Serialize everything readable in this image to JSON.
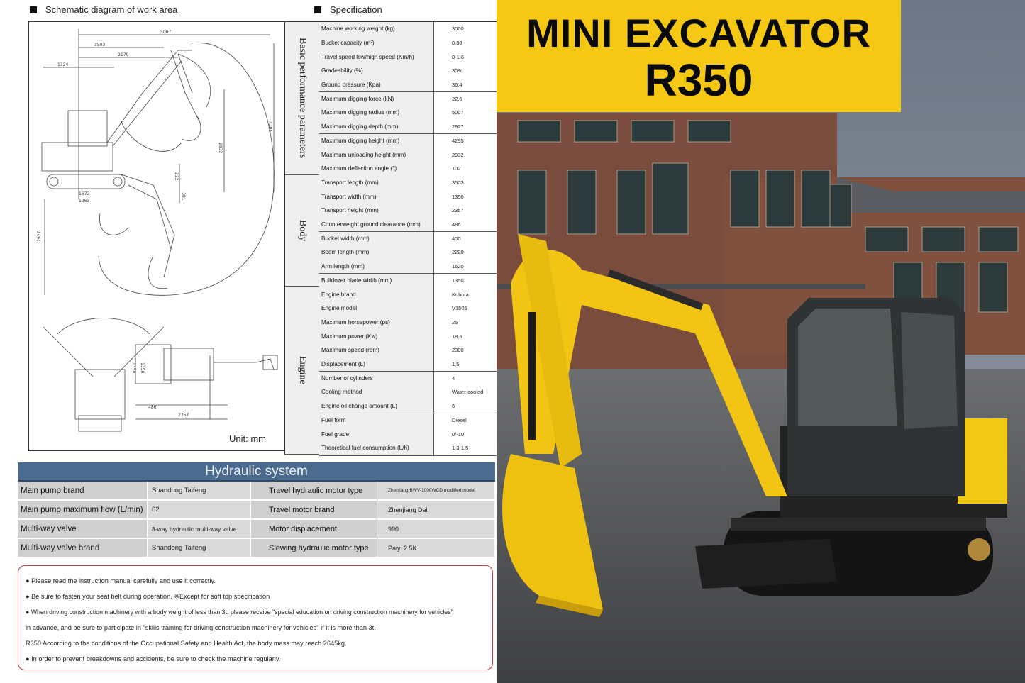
{
  "headers": {
    "schematic": "Schematic diagram of work area",
    "specification": "Specification"
  },
  "diagram": {
    "unit": "Unit: mm",
    "dims": [
      "5007",
      "3503",
      "2179",
      "1324",
      "4295",
      "2932",
      "222",
      "381",
      "1572",
      "1963",
      "2927",
      "1350",
      "2357",
      "486",
      "1350"
    ]
  },
  "spec_groups": [
    {
      "name": "Basic performance parameters",
      "rows": [
        {
          "label": "Machine working weight (kg)",
          "value": "3000"
        },
        {
          "label": "Bucket capacity (m³)",
          "value": "0.08"
        },
        {
          "label": "Travel speed low/high speed (Km/h)",
          "value": "0-1.6"
        },
        {
          "label": "Gradeability (%)",
          "value": "30%"
        },
        {
          "label": "Ground pressure (Kpa)",
          "value": "36.4"
        },
        {
          "label": "Maximum digging force (kN)",
          "value": "22.5"
        },
        {
          "label": "Maximum digging radius (mm)",
          "value": "5007"
        },
        {
          "label": "Maximum digging depth (mm)",
          "value": "2927"
        },
        {
          "label": "Maximum digging height (mm)",
          "value": "4295"
        },
        {
          "label": "Maximum unloading height (mm)",
          "value": "2932"
        },
        {
          "label": "Maximum deflection angle (°)",
          "value": "102"
        }
      ]
    },
    {
      "name": "Body",
      "rows": [
        {
          "label": "Transport length (mm)",
          "value": "3503"
        },
        {
          "label": "Transport width (mm)",
          "value": "1350"
        },
        {
          "label": "Transport height (mm)",
          "value": "2357"
        },
        {
          "label": "Counterweight ground clearance (mm)",
          "value": "486"
        },
        {
          "label": "Bucket width (mm)",
          "value": "400"
        },
        {
          "label": "Boom length (mm)",
          "value": "2220"
        },
        {
          "label": "Arm length (mm)",
          "value": "1620"
        },
        {
          "label": "Bulldozer blade width (mm)",
          "value": "1350"
        }
      ]
    },
    {
      "name": "Engine",
      "rows": [
        {
          "label": "Engine brand",
          "value": "Kubota"
        },
        {
          "label": "Engine model",
          "value": "V1505"
        },
        {
          "label": "Maximum horsepower (ps)",
          "value": "25"
        },
        {
          "label": "Maximum power (Kw)",
          "value": "18.5"
        },
        {
          "label": "Maximum speed (rpm)",
          "value": "2300"
        },
        {
          "label": "Displacement (L)",
          "value": "1.5"
        },
        {
          "label": "Number of cylinders",
          "value": "4"
        },
        {
          "label": "Cooling method",
          "value": "Water-cooled"
        },
        {
          "label": "Engine oil change amount (L)",
          "value": "6"
        },
        {
          "label": "Fuel form",
          "value": "Diesel"
        },
        {
          "label": "Fuel grade",
          "value": "0/-10"
        },
        {
          "label": "Theoretical fuel consumption (L/h)",
          "value": "1.3-1.5"
        }
      ]
    }
  ],
  "hydraulic": {
    "title": "Hydraulic system",
    "rows": [
      {
        "k1": "Main pump brand",
        "v1": "Shandong Taifeng",
        "k2": "Travel hydraulic motor type",
        "v2": "Zhenjiang BWV-1000WCD modified model"
      },
      {
        "k1": "Main pump maximum flow (L/min)",
        "v1": "62",
        "k2": "Travel motor brand",
        "v2": "Zhenjiang Dali"
      },
      {
        "k1": "Multi-way valve",
        "v1": "8-way hydraulic multi-way valve",
        "k2": "Motor displacement",
        "v2": "990"
      },
      {
        "k1": "Multi-way valve brand",
        "v1": "Shandong Taifeng",
        "k2": "Slewing hydraulic motor type",
        "v2": "Paiyi 2.5K"
      }
    ]
  },
  "notes": [
    "● Please read the instruction manual carefully and use it correctly.",
    "● Be sure to fasten your seat belt during operation. ※Except for soft top specification",
    "● When driving construction machinery with a body weight of less than 3t, please receive \"special education on driving construction machinery for vehicles\"",
    "in advance, and be sure to participate in \"skills training for driving construction machinery for vehicles\" if it is more than 3t.",
    "R350 According to the conditions of the Occupational Safety and Health Act, the body mass may reach 2645kg",
    "● In order to prevent breakdowns and accidents, be sure to check the machine regularly."
  ],
  "banner": {
    "title": "MINI EXCAVATOR",
    "model": "R350",
    "color": "#f4c814"
  }
}
